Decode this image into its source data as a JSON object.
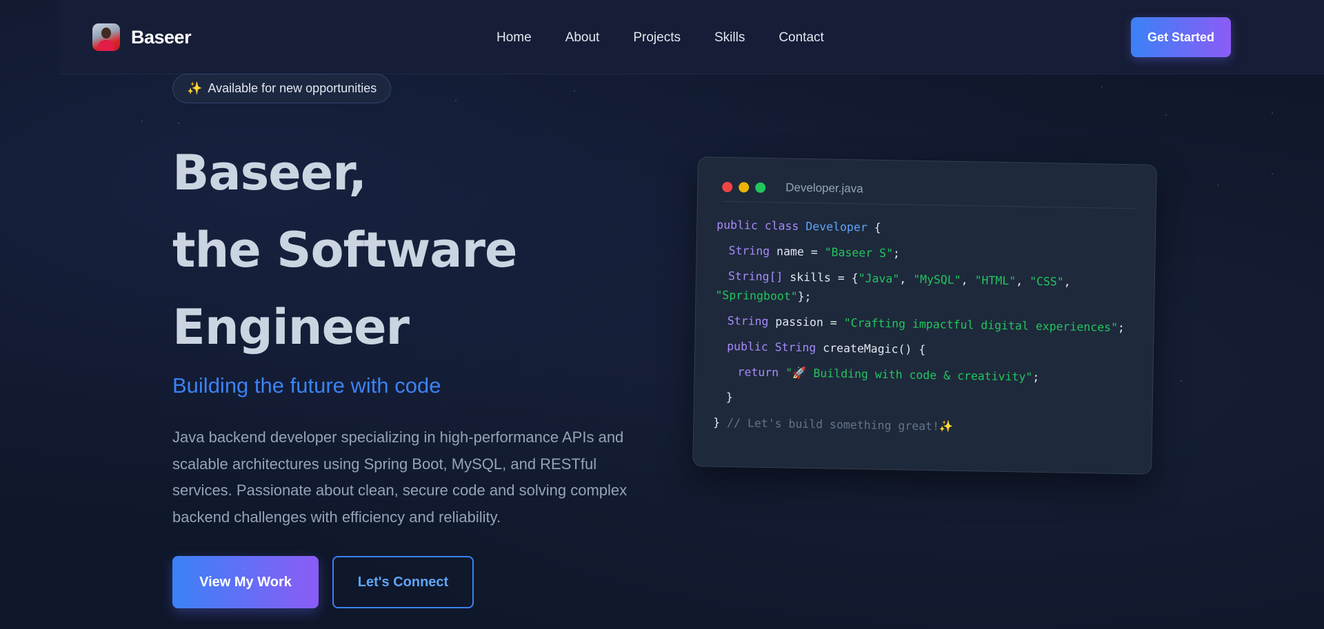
{
  "nav": {
    "brand": "Baseer",
    "links": [
      "Home",
      "About",
      "Projects",
      "Skills",
      "Contact"
    ],
    "cta": "Get Started"
  },
  "hero": {
    "badge_icon": "✨",
    "badge": "Available for new opportunities",
    "title_lines": [
      "Baseer,",
      "the Software",
      "Engineer"
    ],
    "subtitle": "Building the future with code",
    "description": "Java backend developer specializing in high-performance APIs and scalable architectures using Spring Boot, MySQL, and RESTful services. Passionate about clean, secure code and solving complex backend challenges with efficiency and reliability.",
    "primary_button": "View My Work",
    "secondary_button": "Let's Connect"
  },
  "code_card": {
    "filename": "Developer.java",
    "tokens": {
      "public": "public",
      "class": "class",
      "Developer": "Developer",
      "brace_open": " {",
      "String": "String",
      "name_decl": " name = ",
      "name_val": "\"Baseer S\"",
      "semi": ";",
      "StringArr": "String[]",
      "skills_decl": " skills = {",
      "skill_java": "\"Java\"",
      "skill_mysql": "\"MySQL\"",
      "skill_html": "\"HTML\"",
      "skill_css": "\"CSS\"",
      "skill_spring": "\"Springboot\"",
      "comma": ", ",
      "comma_end": ",",
      "arr_close": "};",
      "passion_decl": " passion = ",
      "passion_val": "\"Crafting impactful digital experiences\"",
      "method": " createMagic() {",
      "return": "return",
      "return_val": "\"🚀 Building with code & creativity\"",
      "close_brace": "}",
      "comment": "// Let's build something great!",
      "comment_icon": "✨"
    }
  },
  "colors": {
    "background": "#0f172a",
    "accent_blue": "#3b82f6",
    "accent_purple": "#8b5cf6",
    "code_keyword": "#a78bfa",
    "code_string": "#22c55e"
  }
}
